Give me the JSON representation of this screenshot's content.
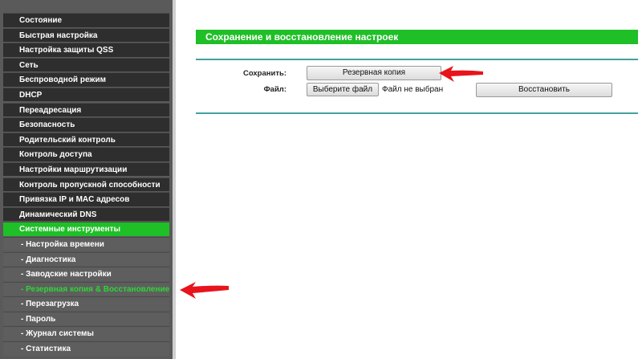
{
  "sidebar": {
    "items": [
      {
        "label": "Состояние",
        "kind": "main",
        "state": "normal"
      },
      {
        "label": "Быстрая настройка",
        "kind": "main",
        "state": "normal"
      },
      {
        "label": "Настройка защиты QSS",
        "kind": "main",
        "state": "normal"
      },
      {
        "label": "Сеть",
        "kind": "main",
        "state": "normal"
      },
      {
        "label": "Беспроводной режим",
        "kind": "main",
        "state": "normal"
      },
      {
        "label": "DHCP",
        "kind": "main",
        "state": "normal"
      },
      {
        "label": "Переадресация",
        "kind": "main",
        "state": "normal"
      },
      {
        "label": "Безопасность",
        "kind": "main",
        "state": "normal"
      },
      {
        "label": "Родительский контроль",
        "kind": "main",
        "state": "normal"
      },
      {
        "label": "Контроль доступа",
        "kind": "main",
        "state": "normal"
      },
      {
        "label": "Настройки маршрутизации",
        "kind": "main",
        "state": "normal"
      },
      {
        "label": "Контроль пропускной способности",
        "kind": "main",
        "state": "normal"
      },
      {
        "label": "Привязка IP и MAC адресов",
        "kind": "main",
        "state": "normal"
      },
      {
        "label": "Динамический DNS",
        "kind": "main",
        "state": "normal"
      },
      {
        "label": "Системные инструменты",
        "kind": "main",
        "state": "active-parent"
      },
      {
        "label": "- Настройка времени",
        "kind": "sub",
        "state": "normal"
      },
      {
        "label": "- Диагностика",
        "kind": "sub",
        "state": "normal"
      },
      {
        "label": "- Заводские настройки",
        "kind": "sub",
        "state": "normal"
      },
      {
        "label": "- Резервная копия & Восстановление",
        "kind": "sub",
        "state": "active-sub"
      },
      {
        "label": "- Перезагрузка",
        "kind": "sub",
        "state": "normal"
      },
      {
        "label": "- Пароль",
        "kind": "sub",
        "state": "normal"
      },
      {
        "label": "- Журнал системы",
        "kind": "sub",
        "state": "normal"
      },
      {
        "label": "- Статистика",
        "kind": "sub",
        "state": "normal"
      }
    ]
  },
  "main": {
    "section_title": "Сохранение и восстановление настроек",
    "save_label": "Сохранить:",
    "backup_button": "Резервная копия",
    "file_label": "Файл:",
    "choose_file_button": "Выберите файл",
    "no_file_text": "Файл не выбран",
    "restore_button": "Восстановить"
  },
  "colors": {
    "accent_green": "#1fbf27",
    "active_sub_text": "#2fd635",
    "annotation_red": "#e8141b"
  },
  "icons": {
    "annotation_arrow_top": "red-arrow-left-icon",
    "annotation_arrow_sidebar": "red-arrow-left-icon"
  }
}
